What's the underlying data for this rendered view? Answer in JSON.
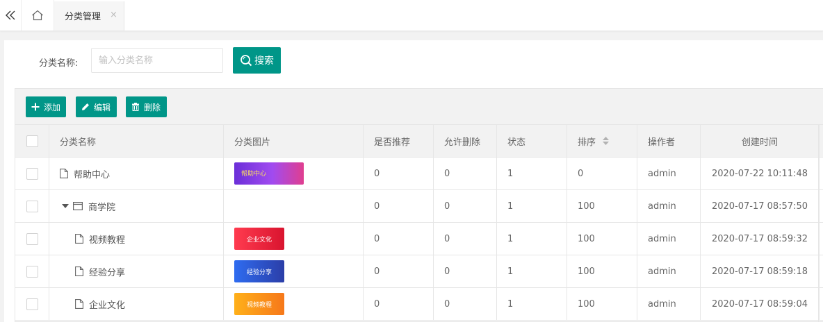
{
  "tabs": {
    "active_label": "分类管理",
    "close_glyph": "×"
  },
  "search": {
    "label": "分类名称:",
    "placeholder": "输入分类名称",
    "button_label": "搜索"
  },
  "toolbar": {
    "add_label": "添加",
    "edit_label": "编辑",
    "delete_label": "删除"
  },
  "columns": [
    "分类名称",
    "分类图片",
    "是否推荐",
    "允许删除",
    "状态",
    "排序",
    "操作者",
    "创建时间"
  ],
  "rows": [
    {
      "name": "帮助中心",
      "level": 0,
      "icon": "file-icon",
      "thumb": "帮助中心",
      "recommend": "0",
      "deletable": "0",
      "status": "1",
      "sort": "0",
      "operator": "admin",
      "created": "2020-07-22 10:11:48"
    },
    {
      "name": "商学院",
      "level": 0,
      "icon": "folder-icon",
      "thumb": "",
      "recommend": "0",
      "deletable": "0",
      "status": "1",
      "sort": "100",
      "operator": "admin",
      "created": "2020-07-17 08:57:50"
    },
    {
      "name": "视频教程",
      "level": 1,
      "icon": "file-icon",
      "thumb": "企业文化",
      "recommend": "0",
      "deletable": "0",
      "status": "1",
      "sort": "100",
      "operator": "admin",
      "created": "2020-07-17 08:59:32"
    },
    {
      "name": "经验分享",
      "level": 1,
      "icon": "file-icon",
      "thumb": "经验分享",
      "recommend": "0",
      "deletable": "0",
      "status": "1",
      "sort": "100",
      "operator": "admin",
      "created": "2020-07-17 08:59:18"
    },
    {
      "name": "企业文化",
      "level": 1,
      "icon": "file-icon",
      "thumb": "视频教程",
      "recommend": "0",
      "deletable": "0",
      "status": "1",
      "sort": "100",
      "operator": "admin",
      "created": "2020-07-17 08:59:04"
    }
  ],
  "colors": {
    "primary": "#009688",
    "header_bg": "#f2f2f2",
    "thumb_purple": "#7b3fe4",
    "thumb_red": "#f0304a",
    "thumb_blue": "#2f5fe0",
    "thumb_orange": "#fb8c1c"
  }
}
